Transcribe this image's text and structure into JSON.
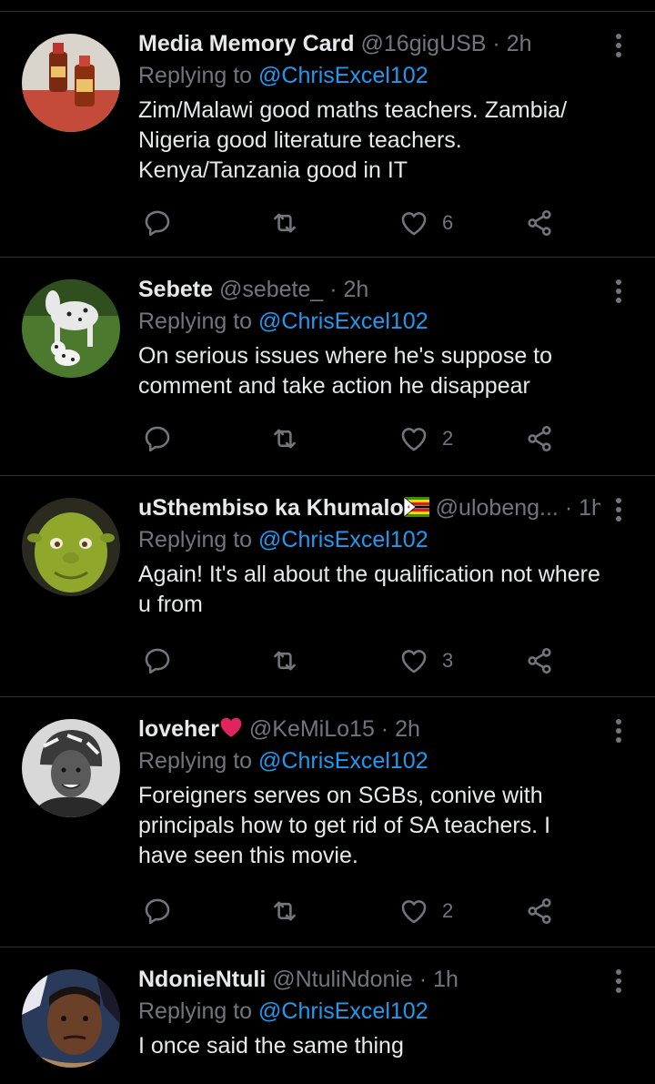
{
  "colors": {
    "background": "#000000",
    "text": "#e7e9ea",
    "muted": "#71767b",
    "link": "#1d9bf0",
    "divider": "#2f3336",
    "heart": "#e0245e"
  },
  "tweets": [
    {
      "name": "Media Memory Card",
      "handle": "@16gigUSB",
      "dot": "·",
      "time": "2h",
      "reply_prefix": "Replying to",
      "reply_to": "@ChrisExcel102",
      "text": "Zim/Malawi good maths teachers. Zambia/ Nigeria good literature teachers. Kenya/Tanzania good in IT",
      "likes": "6",
      "avatar": "bottles-photo"
    },
    {
      "name": "Sebete",
      "handle": "@sebete_",
      "dot": "·",
      "time": "2h",
      "reply_prefix": "Replying to",
      "reply_to": "@ChrisExcel102",
      "text": "On serious issues where he's suppose to comment and take action he disappear",
      "likes": "2",
      "avatar": "spotted-horse-and-dog-photo"
    },
    {
      "name": "uSthembiso ka Khumalo",
      "name_emoji": "zimbabwe-flag-icon",
      "handle": "@ulobeng...",
      "dot": "·",
      "time": "1h",
      "reply_prefix": "Replying to",
      "reply_to": "@ChrisExcel102",
      "text": "Again! It's all about the qualification not where u from",
      "likes": "3",
      "avatar": "green-ogre-photo"
    },
    {
      "name": "loveher",
      "name_emoji": "red-heart-icon",
      "handle": "@KeMiLo15",
      "dot": "·",
      "time": "2h",
      "reply_prefix": "Replying to",
      "reply_to": "@ChrisExcel102",
      "text": "Foreigners serves on SGBs, conive with principals how to get rid of SA teachers. I have seen this movie.",
      "likes": "2",
      "avatar": "woman-headwrap-bw-photo"
    },
    {
      "name": "NdonieNtuli",
      "handle": "@NtuliNdonie",
      "dot": "·",
      "time": "1h",
      "reply_prefix": "Replying to",
      "reply_to": "@ChrisExcel102",
      "text": "I once said the same thing",
      "avatar": "man-selfie-photo"
    }
  ]
}
